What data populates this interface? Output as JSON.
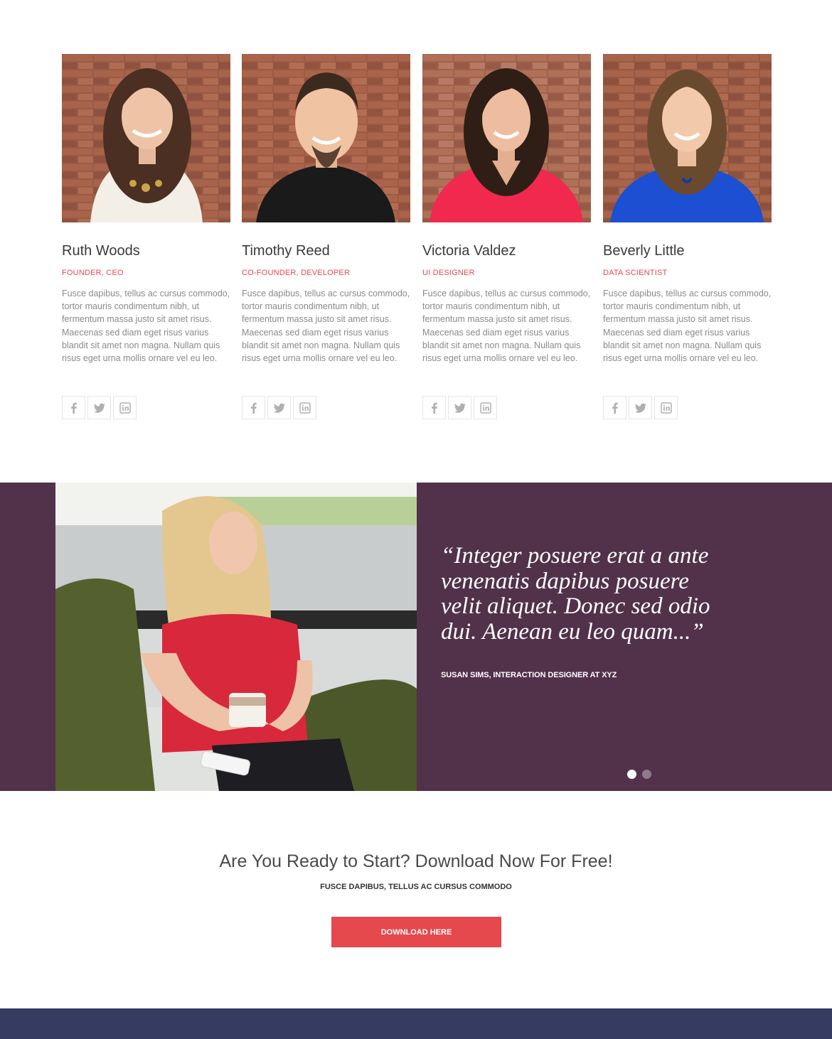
{
  "team": {
    "members": [
      {
        "name": "Ruth Woods",
        "role": "FOUNDER, CEO",
        "bio": "Fusce dapibus, tellus ac cursus commodo, tortor mauris condimentum nibh, ut fermentum massa justo sit amet risus. Maecenas sed diam eget risus varius blandit sit amet non magna. Nullam quis risus eget urna mollis ornare vel eu leo.",
        "shirt_color": "#f4efe6",
        "hair_color": "#4a2f22"
      },
      {
        "name": "Timothy Reed",
        "role": "CO-FOUNDER, DEVELOPER",
        "bio": "Fusce dapibus, tellus ac cursus commodo, tortor mauris condimentum nibh, ut fermentum massa justo sit amet risus. Maecenas sed diam eget risus varius blandit sit amet non magna. Nullam quis risus eget urna mollis ornare vel eu leo.",
        "shirt_color": "#1a1a1a",
        "hair_color": "#3b2a1e"
      },
      {
        "name": "Victoria Valdez",
        "role": "UI DESIGNER",
        "bio": "Fusce dapibus, tellus ac cursus commodo, tortor mauris condimentum nibh, ut fermentum massa justo sit amet risus. Maecenas sed diam eget risus varius blandit sit amet non magna. Nullam quis risus eget urna mollis ornare vel eu leo.",
        "shirt_color": "#f1294e",
        "hair_color": "#2e1e16"
      },
      {
        "name": "Beverly Little",
        "role": "DATA SCIENTIST",
        "bio": "Fusce dapibus, tellus ac cursus commodo, tortor mauris condimentum nibh, ut fermentum massa justo sit amet risus. Maecenas sed diam eget risus varius blandit sit amet non magna. Nullam quis risus eget urna mollis ornare vel eu leo.",
        "shirt_color": "#1c4fd1",
        "hair_color": "#6a4a2e"
      }
    ],
    "social_icons": [
      "facebook-icon",
      "twitter-icon",
      "linkedin-icon"
    ]
  },
  "testimonial": {
    "quote": "“Integer posuere erat a ante venenatis dapibus posuere velit aliquet. Donec sed odio dui. Aenean eu leo quam...”",
    "author": "SUSAN SIMS, INTERACTION DESIGNER AT XYZ",
    "slide_count": 2,
    "active_slide": 1
  },
  "cta": {
    "title": "Are You Ready to Start? Download Now For Free!",
    "subtitle": "FUSCE DAPIBUS, TELLUS AC CURSUS COMMODO",
    "button_label": "DOWNLOAD HERE"
  },
  "colors": {
    "accent": "#e5484d",
    "testimonial_bg": "#51324a",
    "footer_bg": "#363b61",
    "text_muted": "#8a8a8a"
  }
}
